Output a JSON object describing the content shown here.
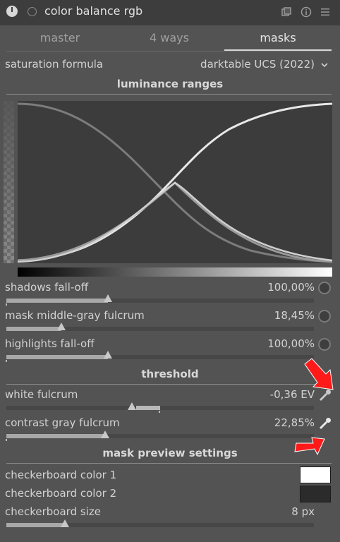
{
  "module": {
    "title": "color balance rgb"
  },
  "tabs": [
    {
      "label": "master",
      "active": false
    },
    {
      "label": "4 ways",
      "active": false
    },
    {
      "label": "masks",
      "active": true
    }
  ],
  "saturation": {
    "label": "saturation formula",
    "value": "darktable UCS (2022)"
  },
  "sections": {
    "luminance": "luminance ranges",
    "threshold": "threshold",
    "preview": "mask preview settings"
  },
  "sliders": {
    "shadows": {
      "label": "shadows fall-off",
      "value": "100,00%",
      "level": 0.33
    },
    "midgray": {
      "label": "mask middle-gray fulcrum",
      "value": "18,45%",
      "level": 0.18
    },
    "highlights": {
      "label": "highlights fall-off",
      "value": "100,00%",
      "level": 0.33
    },
    "white": {
      "label": "white fulcrum",
      "value": "-0,36 EV"
    },
    "contrast": {
      "label": "contrast gray fulcrum",
      "value": "22,85%",
      "level": 0.32
    },
    "cbsize": {
      "label": "checkerboard size",
      "value": "8 px",
      "level": 0.19
    }
  },
  "checkerboard": {
    "color1": {
      "label": "checkerboard color 1",
      "swatch": "#ffffff"
    },
    "color2": {
      "label": "checkerboard color 2",
      "swatch": "#2b2b2b"
    }
  },
  "colors": {
    "graph_bg": "#3c3c3c",
    "panel_bg": "#535353",
    "annotation": "#ff1a1a"
  }
}
